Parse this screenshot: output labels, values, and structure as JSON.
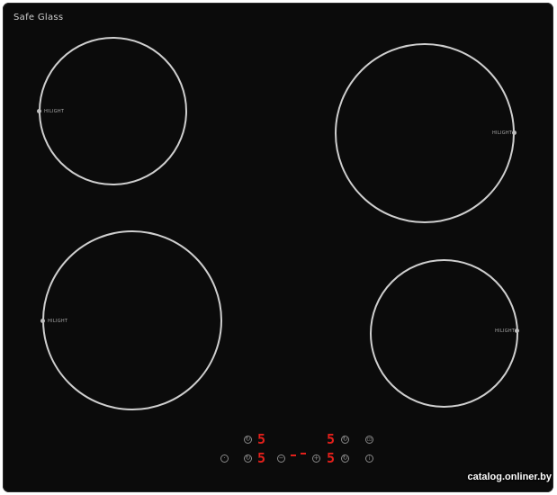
{
  "brand": "Safe Glass",
  "zone_label": "HILIGHT",
  "watermark": "catalog.onliner.by",
  "controls": {
    "top_left_level": "5",
    "top_right_level": "5",
    "bottom_left_level": "5",
    "bottom_right_level": "5",
    "minus_symbol": "−",
    "plus_symbol": "+",
    "power_symbol": "⏻",
    "lock_symbol": "🔒"
  },
  "colors": {
    "glass": "#0b0b0b",
    "ring": "#cfcfcf",
    "display_red": "#e3201b"
  }
}
